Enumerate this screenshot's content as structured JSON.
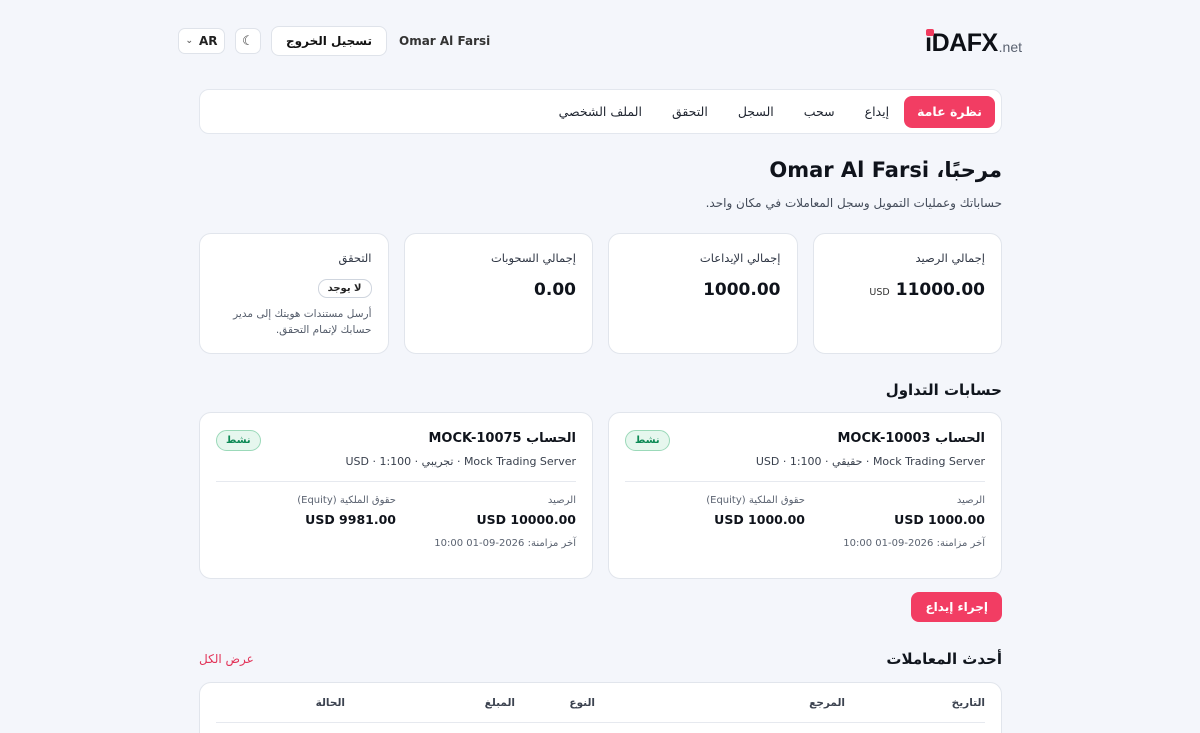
{
  "header": {
    "brand": "iDAFX",
    "brand_suffix": ".net",
    "user_name": "Omar Al Farsi",
    "logout_label": "تسجيل الخروج",
    "language": "AR"
  },
  "nav": {
    "items": [
      {
        "label": "نظرة عامة",
        "active": true
      },
      {
        "label": "إيداع"
      },
      {
        "label": "سحب"
      },
      {
        "label": "السجل"
      },
      {
        "label": "التحقق"
      },
      {
        "label": "الملف الشخصي"
      }
    ]
  },
  "hero": {
    "title": "مرحبًا، Omar Al Farsi",
    "subtitle": "حساباتك وعمليات التمويل وسجل المعاملات في مكان واحد."
  },
  "stats": {
    "balance": {
      "label": "إجمالي الرصيد",
      "value": "11000.00",
      "currency": "USD"
    },
    "deposits": {
      "label": "إجمالي الإيداعات",
      "value": "1000.00"
    },
    "withdrawals": {
      "label": "إجمالي السحوبات",
      "value": "0.00"
    },
    "verification": {
      "label": "التحقق",
      "badge": "لا يوجد",
      "note": "أرسل مستندات هويتك إلى مدير حسابك لإتمام التحقق."
    }
  },
  "accounts": {
    "title": "حسابات التداول",
    "items": [
      {
        "title": "الحساب MOCK-10003",
        "meta": "Mock Trading Server · حقيقي · 1:100 · USD",
        "status": "نشط",
        "balance_label": "الرصيد",
        "balance": "USD 1000.00",
        "equity_label": "حقوق الملكية (Equity)",
        "equity": "USD 1000.00",
        "sync": "آخر مزامنة: 2026-09-01 10:00"
      },
      {
        "title": "الحساب MOCK-10075",
        "meta": "Mock Trading Server · تجريبي · 1:100 · USD",
        "status": "نشط",
        "balance_label": "الرصيد",
        "balance": "USD 10000.00",
        "equity_label": "حقوق الملكية (Equity)",
        "equity": "USD 9981.00",
        "sync": "آخر مزامنة: 2026-09-01 10:00"
      }
    ],
    "deposit_button": "إجراء إيداع"
  },
  "transactions": {
    "title": "أحدث المعاملات",
    "view_all": "عرض الكل",
    "columns": [
      "التاريخ",
      "المرجع",
      "النوع",
      "المبلغ",
      "الحالة"
    ]
  }
}
